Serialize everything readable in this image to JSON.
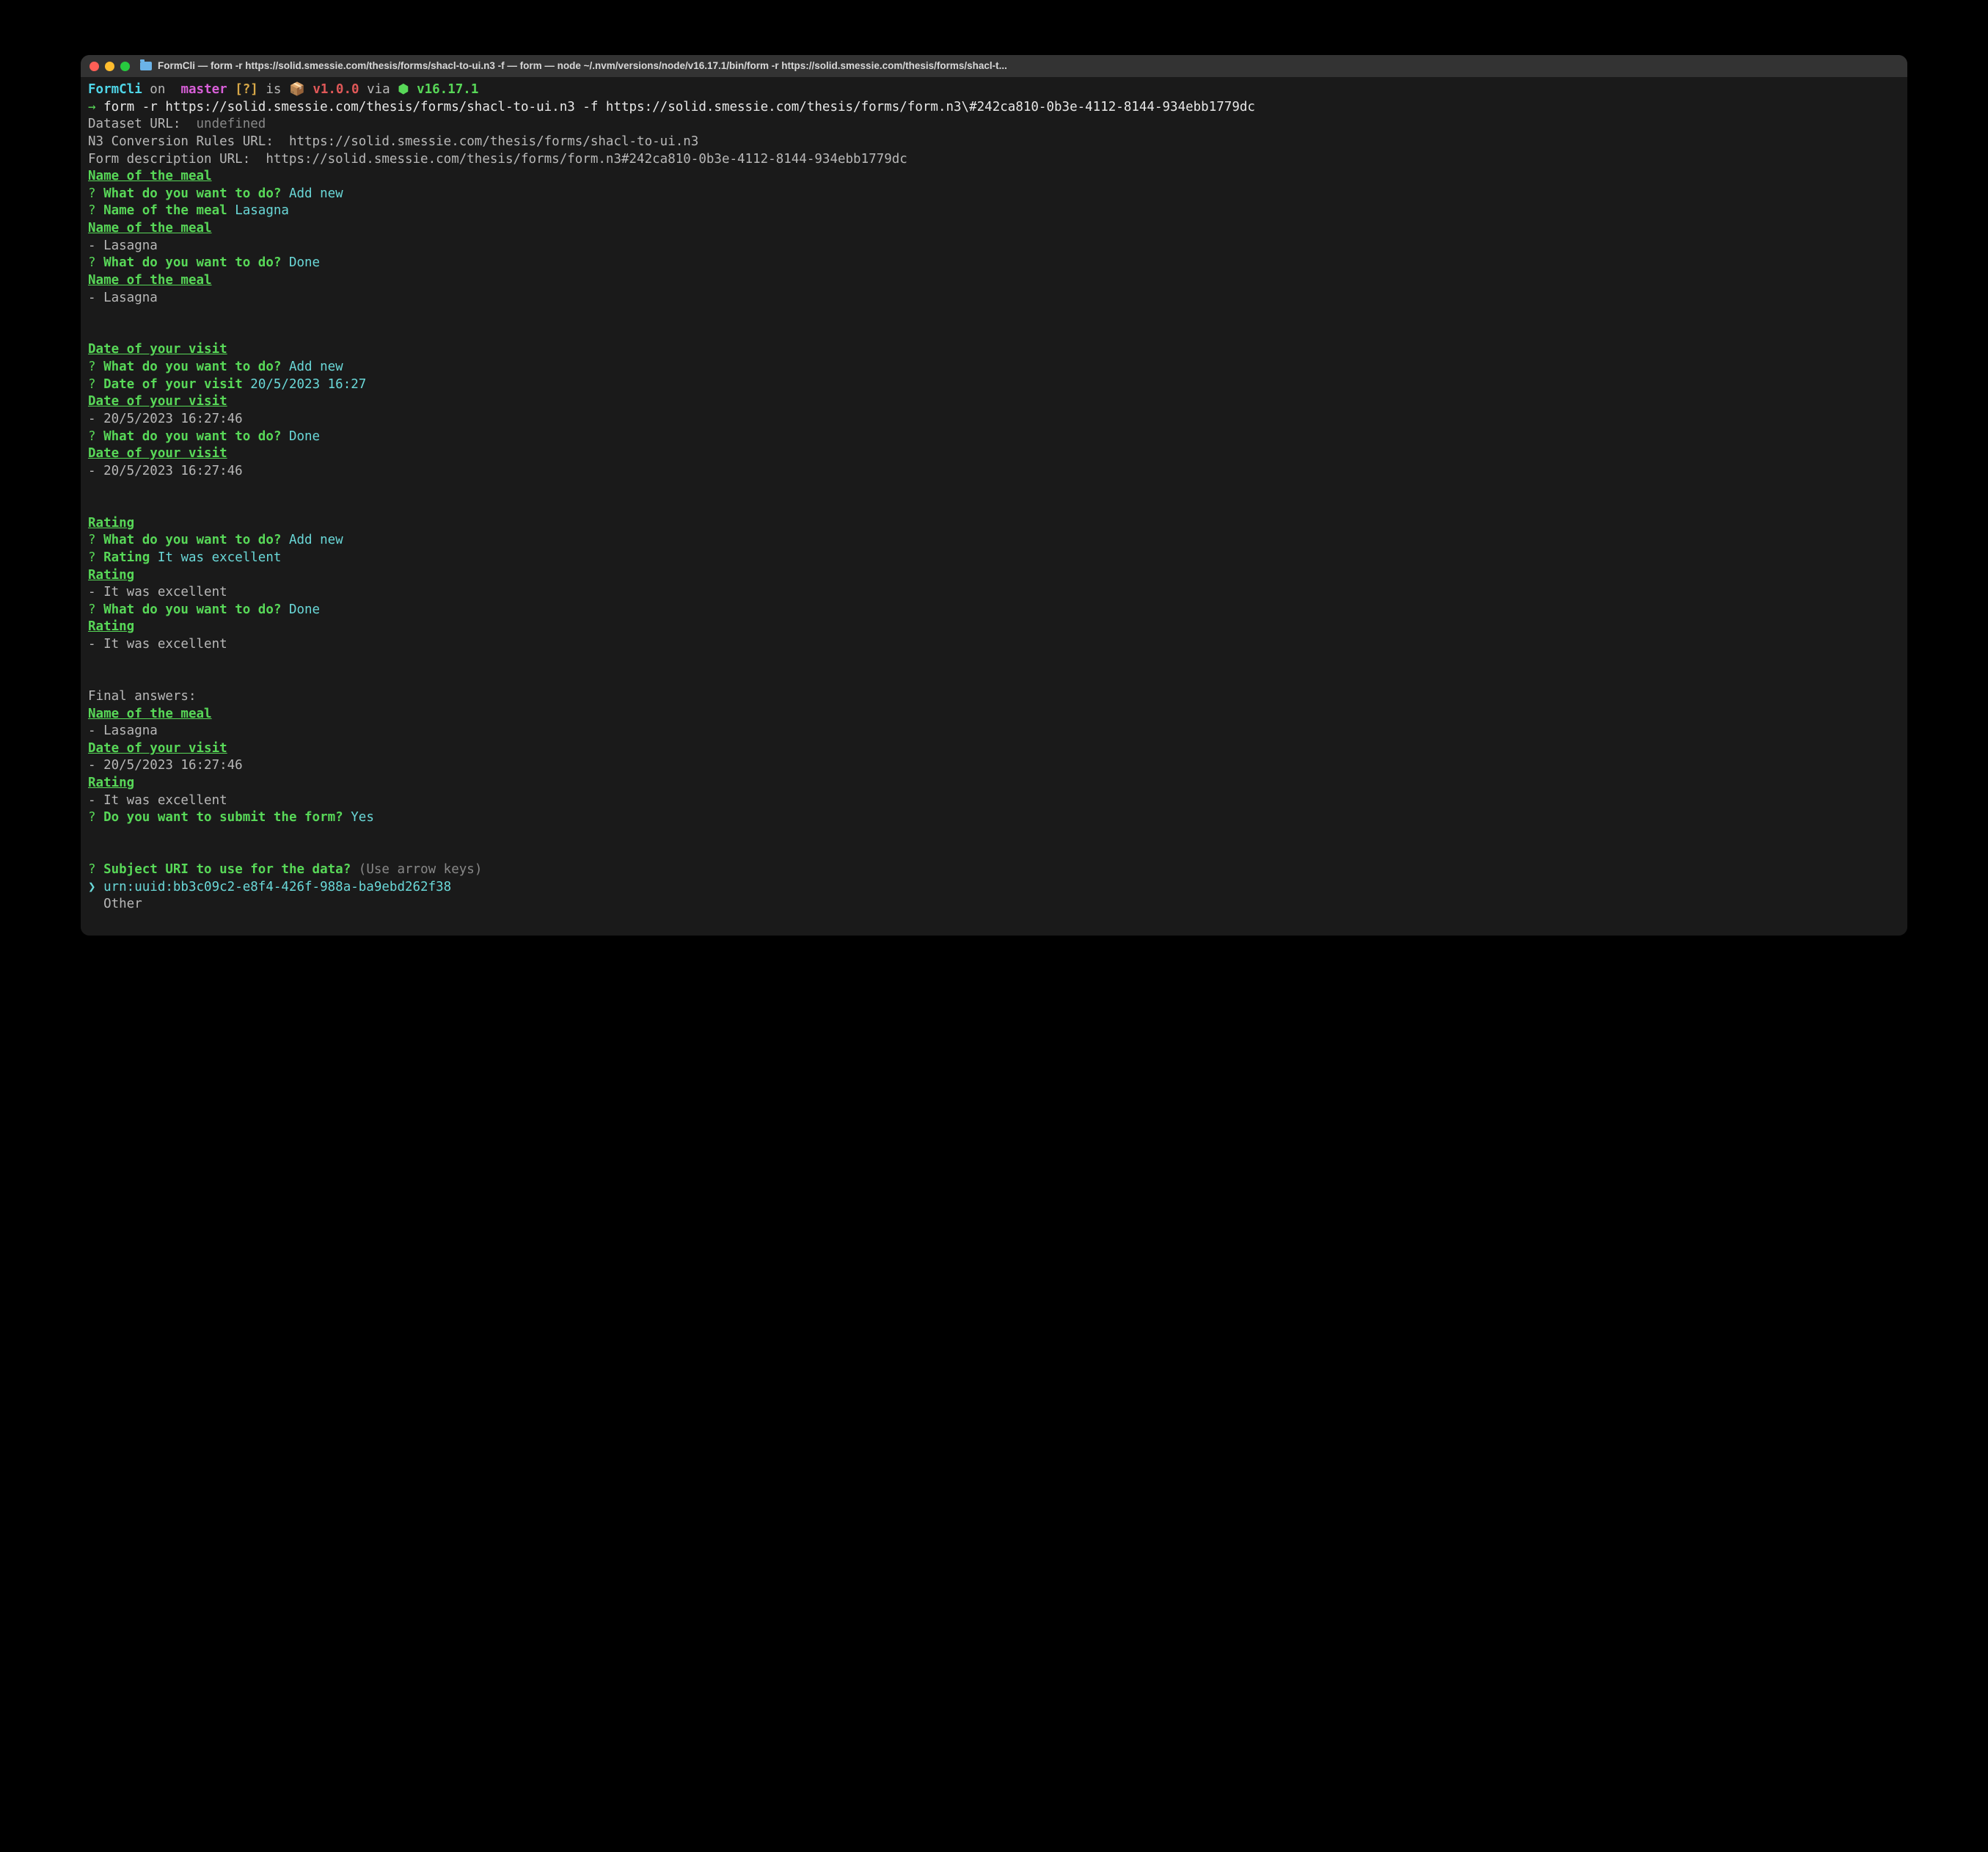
{
  "titlebar": {
    "title": "FormCli — form -r https://solid.smessie.com/thesis/forms/shacl-to-ui.n3 -f — form — node ~/.nvm/versions/node/v16.17.1/bin/form -r https://solid.smessie.com/thesis/forms/shacl-t..."
  },
  "prompt": {
    "app": "FormCli",
    "on": " on ",
    "branch_icon": "",
    "branch": " master",
    "status": " [?]",
    "is": " is ",
    "pkg_icon": "📦 ",
    "version": "v1.0.0",
    "via": " via ",
    "node_icon": "⬢ ",
    "node_version": "v16.17.1",
    "arrow": "→ ",
    "command": "form -r https://solid.smessie.com/thesis/forms/shacl-to-ui.n3 -f https://solid.smessie.com/thesis/forms/form.n3\\#242ca810-0b3e-4112-8144-934ebb1779dc"
  },
  "info": {
    "dataset_label": "Dataset URL:  ",
    "dataset_value": "undefined",
    "rules_label": "N3 Conversion Rules URL:  ",
    "rules_value": "https://solid.smessie.com/thesis/forms/shacl-to-ui.n3",
    "form_label": "Form description URL:  ",
    "form_value": "https://solid.smessie.com/thesis/forms/form.n3#242ca810-0b3e-4112-8144-934ebb1779dc"
  },
  "sections": {
    "meal": {
      "heading": "Name of the meal",
      "q1_prompt": "What do you want to do?",
      "q1_answer": "Add new",
      "q2_prompt": "Name of the meal",
      "q2_answer": "Lasagna",
      "item": "- Lasagna",
      "q3_prompt": "What do you want to do?",
      "q3_answer": "Done"
    },
    "date": {
      "heading": "Date of your visit",
      "q1_prompt": "What do you want to do?",
      "q1_answer": "Add new",
      "q2_prompt": "Date of your visit",
      "q2_answer": "20/5/2023 16:27",
      "item": "- 20/5/2023 16:27:46",
      "q3_prompt": "What do you want to do?",
      "q3_answer": "Done"
    },
    "rating": {
      "heading": "Rating",
      "q1_prompt": "What do you want to do?",
      "q1_answer": "Add new",
      "q2_prompt": "Rating",
      "q2_answer": "It was excellent",
      "item": "- It was excellent",
      "q3_prompt": "What do you want to do?",
      "q3_answer": "Done"
    }
  },
  "final": {
    "heading": "Final answers:",
    "meal_heading": "Name of the meal",
    "meal_item": "- Lasagna",
    "date_heading": "Date of your visit",
    "date_item": "- 20/5/2023 16:27:46",
    "rating_heading": "Rating",
    "rating_item": "- It was excellent",
    "submit_prompt": "Do you want to submit the form?",
    "submit_answer": "Yes"
  },
  "subject": {
    "prompt": "Subject URI to use for the data?",
    "hint": "(Use arrow keys)",
    "pointer": "❯ ",
    "option1": "urn:uuid:bb3c09c2-e8f4-426f-988a-ba9ebd262f38",
    "option2": "  Other"
  },
  "glyphs": {
    "qmark": "? "
  }
}
